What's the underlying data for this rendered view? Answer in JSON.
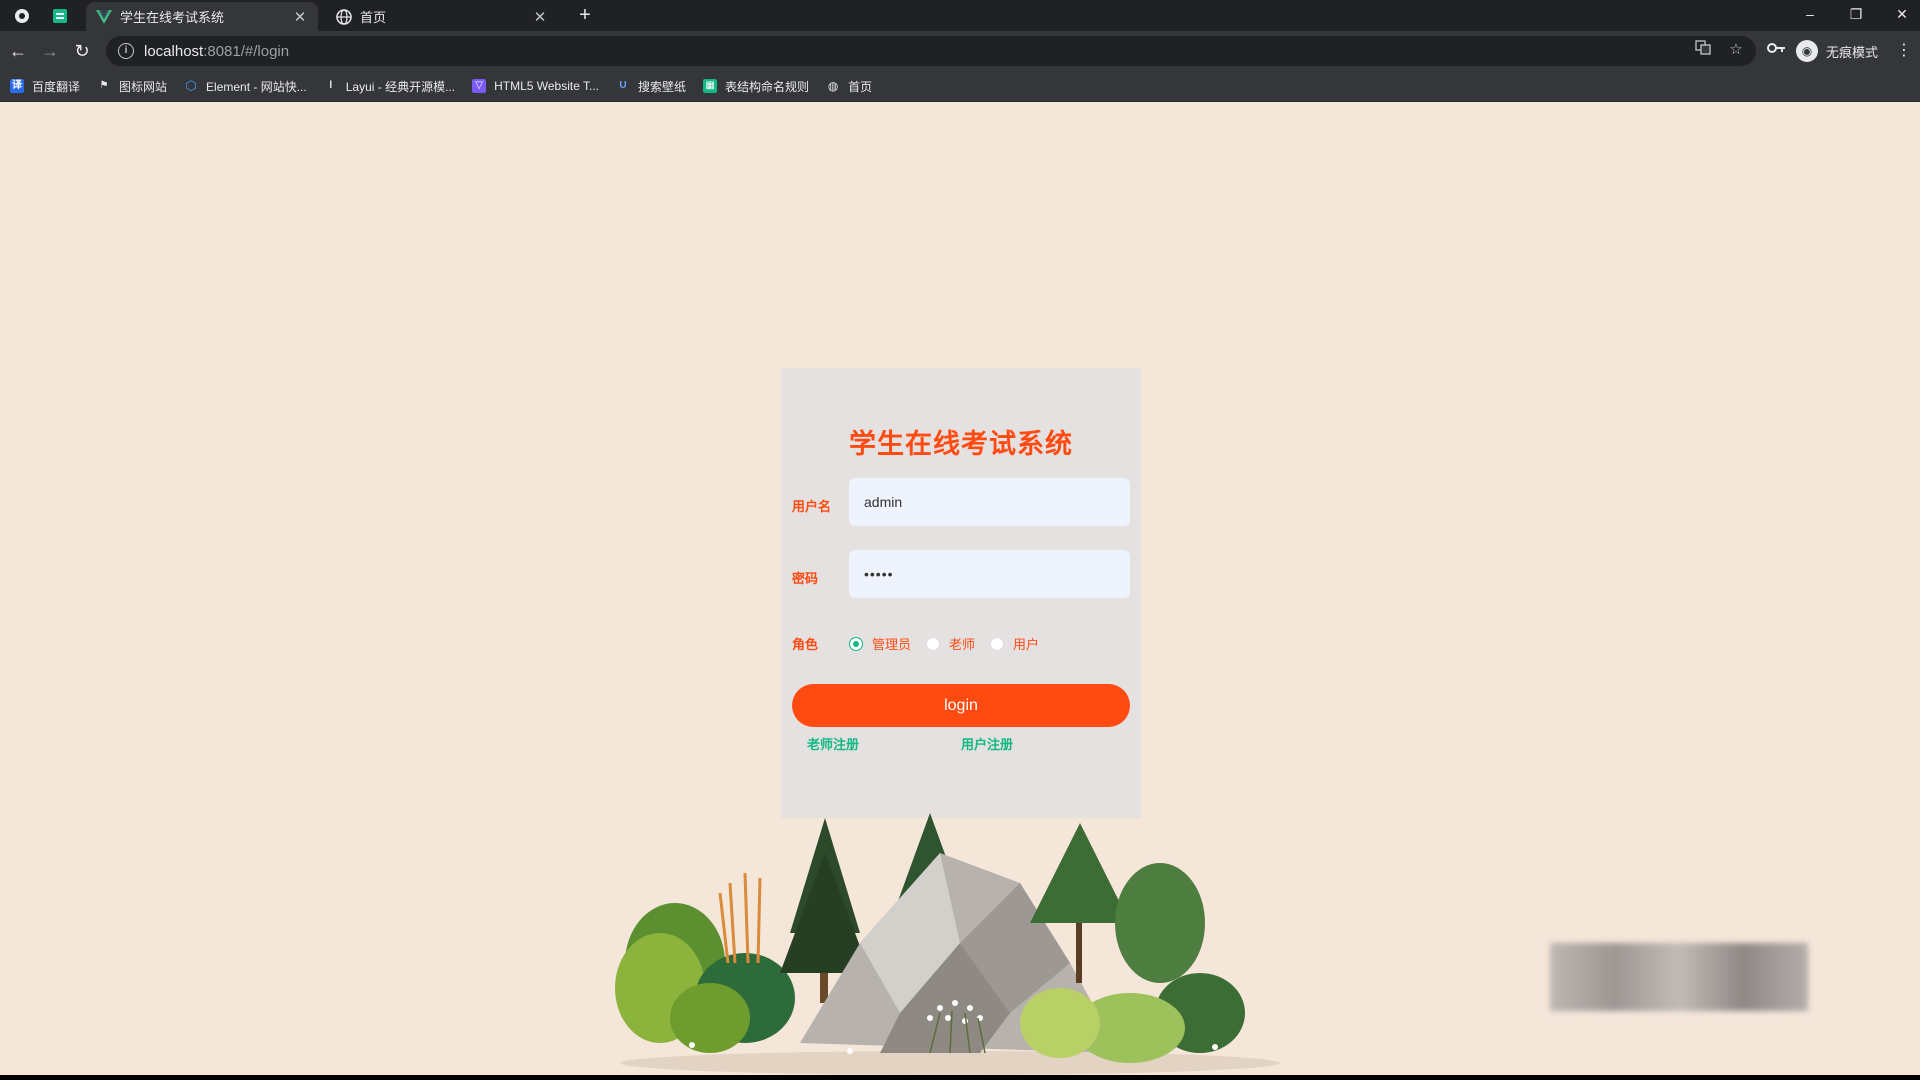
{
  "browser": {
    "tabs": [
      {
        "title": "学生在线考试系统",
        "active": true
      },
      {
        "title": "首页",
        "active": false
      }
    ],
    "url_host": "localhost",
    "url_path": ":8081/#/login",
    "profile_label": "无痕模式",
    "bookmarks": [
      {
        "label": "百度翻译",
        "icon_color": "#2b6de8"
      },
      {
        "label": "图标网站",
        "icon_color": "#35363a"
      },
      {
        "label": "Element - 网站快...",
        "icon_color": "#409eff"
      },
      {
        "label": "Layui - 经典开源模...",
        "icon_color": "#35363a"
      },
      {
        "label": "HTML5 Website T...",
        "icon_color": "#7a5af8"
      },
      {
        "label": "搜索壁纸",
        "icon_color": "#2b6de8"
      },
      {
        "label": "表结构命名规则",
        "icon_color": "#12b886"
      },
      {
        "label": "首页",
        "icon_color": "#35363a"
      }
    ]
  },
  "login": {
    "title": "学生在线考试系统",
    "username_label": "用户名",
    "username_value": "admin",
    "password_label": "密码",
    "password_value": "•••••",
    "role_label": "角色",
    "roles": [
      "管理员",
      "老师",
      "用户"
    ],
    "selected_role": "管理员",
    "login_button": "login",
    "teacher_register": "老师注册",
    "user_register": "用户注册"
  },
  "colors": {
    "accent": "#ff4b12",
    "link": "#12b886",
    "page_bg": "#f5e6da",
    "card_bg": "#e5e1e1"
  }
}
